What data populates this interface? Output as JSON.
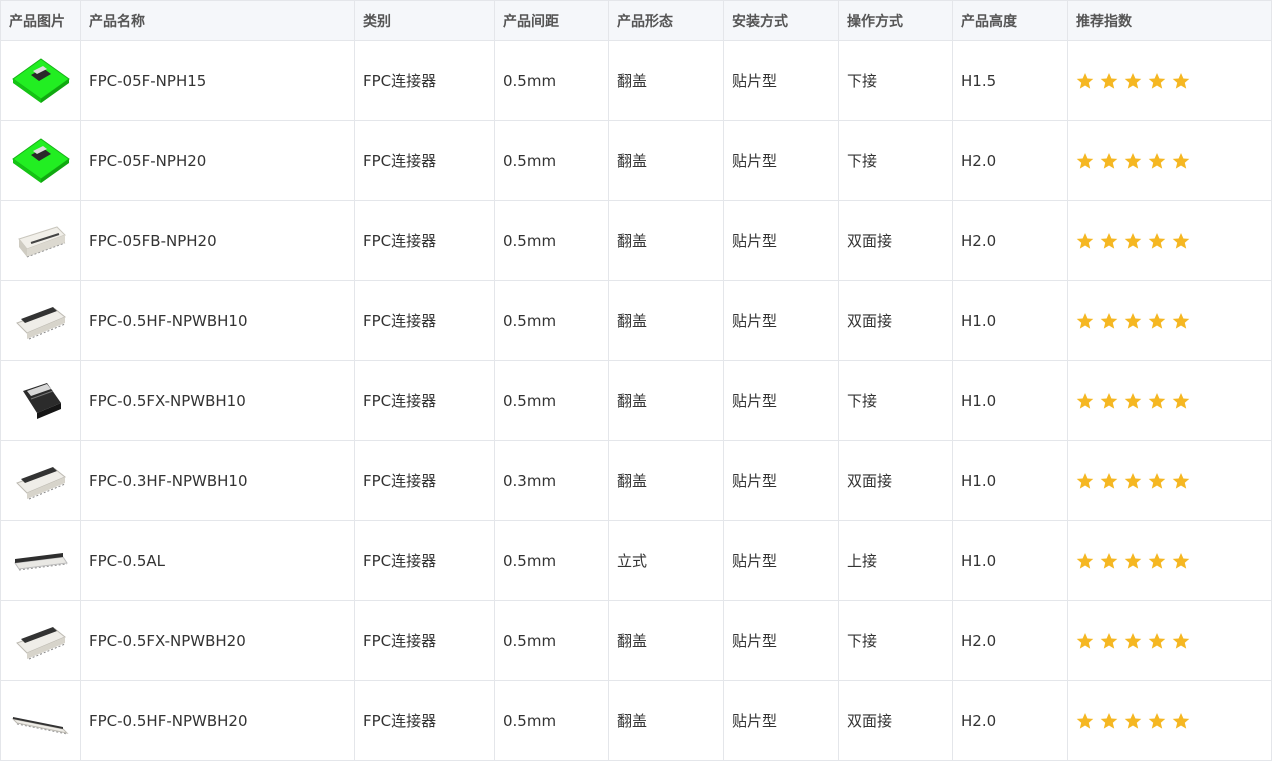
{
  "headers": [
    "产品图片",
    "产品名称",
    "类别",
    "产品间距",
    "产品形态",
    "安装方式",
    "操作方式",
    "产品高度",
    "推荐指数"
  ],
  "colors": {
    "star": "#f5b722",
    "border": "#e4e6ea",
    "header_bg": "#f5f7fa",
    "pcb_green": "#22ee22"
  },
  "rows": [
    {
      "thumb_icon": "green-pcb-connector-icon",
      "name": "FPC-05F-NPH15",
      "category": "FPC连接器",
      "pitch": "0.5mm",
      "shape": "翻盖",
      "mount": "贴片型",
      "operation": "下接",
      "height": "H1.5",
      "rating": 5
    },
    {
      "thumb_icon": "green-pcb-connector-icon",
      "name": "FPC-05F-NPH20",
      "category": "FPC连接器",
      "pitch": "0.5mm",
      "shape": "翻盖",
      "mount": "贴片型",
      "operation": "下接",
      "height": "H2.0",
      "rating": 5
    },
    {
      "thumb_icon": "white-connector-icon",
      "name": "FPC-05FB-NPH20",
      "category": "FPC连接器",
      "pitch": "0.5mm",
      "shape": "翻盖",
      "mount": "贴片型",
      "operation": "双面接",
      "height": "H2.0",
      "rating": 5
    },
    {
      "thumb_icon": "flip-connector-icon",
      "name": "FPC-0.5HF-NPWBH10",
      "category": "FPC连接器",
      "pitch": "0.5mm",
      "shape": "翻盖",
      "mount": "贴片型",
      "operation": "双面接",
      "height": "H1.0",
      "rating": 5
    },
    {
      "thumb_icon": "black-connector-icon",
      "name": "FPC-0.5FX-NPWBH10",
      "category": "FPC连接器",
      "pitch": "0.5mm",
      "shape": "翻盖",
      "mount": "贴片型",
      "operation": "下接",
      "height": "H1.0",
      "rating": 5
    },
    {
      "thumb_icon": "flip-connector-icon",
      "name": "FPC-0.3HF-NPWBH10",
      "category": "FPC连接器",
      "pitch": "0.3mm",
      "shape": "翻盖",
      "mount": "贴片型",
      "operation": "双面接",
      "height": "H1.0",
      "rating": 5
    },
    {
      "thumb_icon": "vertical-connector-icon",
      "name": "FPC-0.5AL",
      "category": "FPC连接器",
      "pitch": "0.5mm",
      "shape": "立式",
      "mount": "贴片型",
      "operation": "上接",
      "height": "H1.0",
      "rating": 5
    },
    {
      "thumb_icon": "flip-connector-icon",
      "name": "FPC-0.5FX-NPWBH20",
      "category": "FPC连接器",
      "pitch": "0.5mm",
      "shape": "翻盖",
      "mount": "贴片型",
      "operation": "下接",
      "height": "H2.0",
      "rating": 5
    },
    {
      "thumb_icon": "slim-connector-icon",
      "name": "FPC-0.5HF-NPWBH20",
      "category": "FPC连接器",
      "pitch": "0.5mm",
      "shape": "翻盖",
      "mount": "贴片型",
      "operation": "双面接",
      "height": "H2.0",
      "rating": 5
    }
  ]
}
